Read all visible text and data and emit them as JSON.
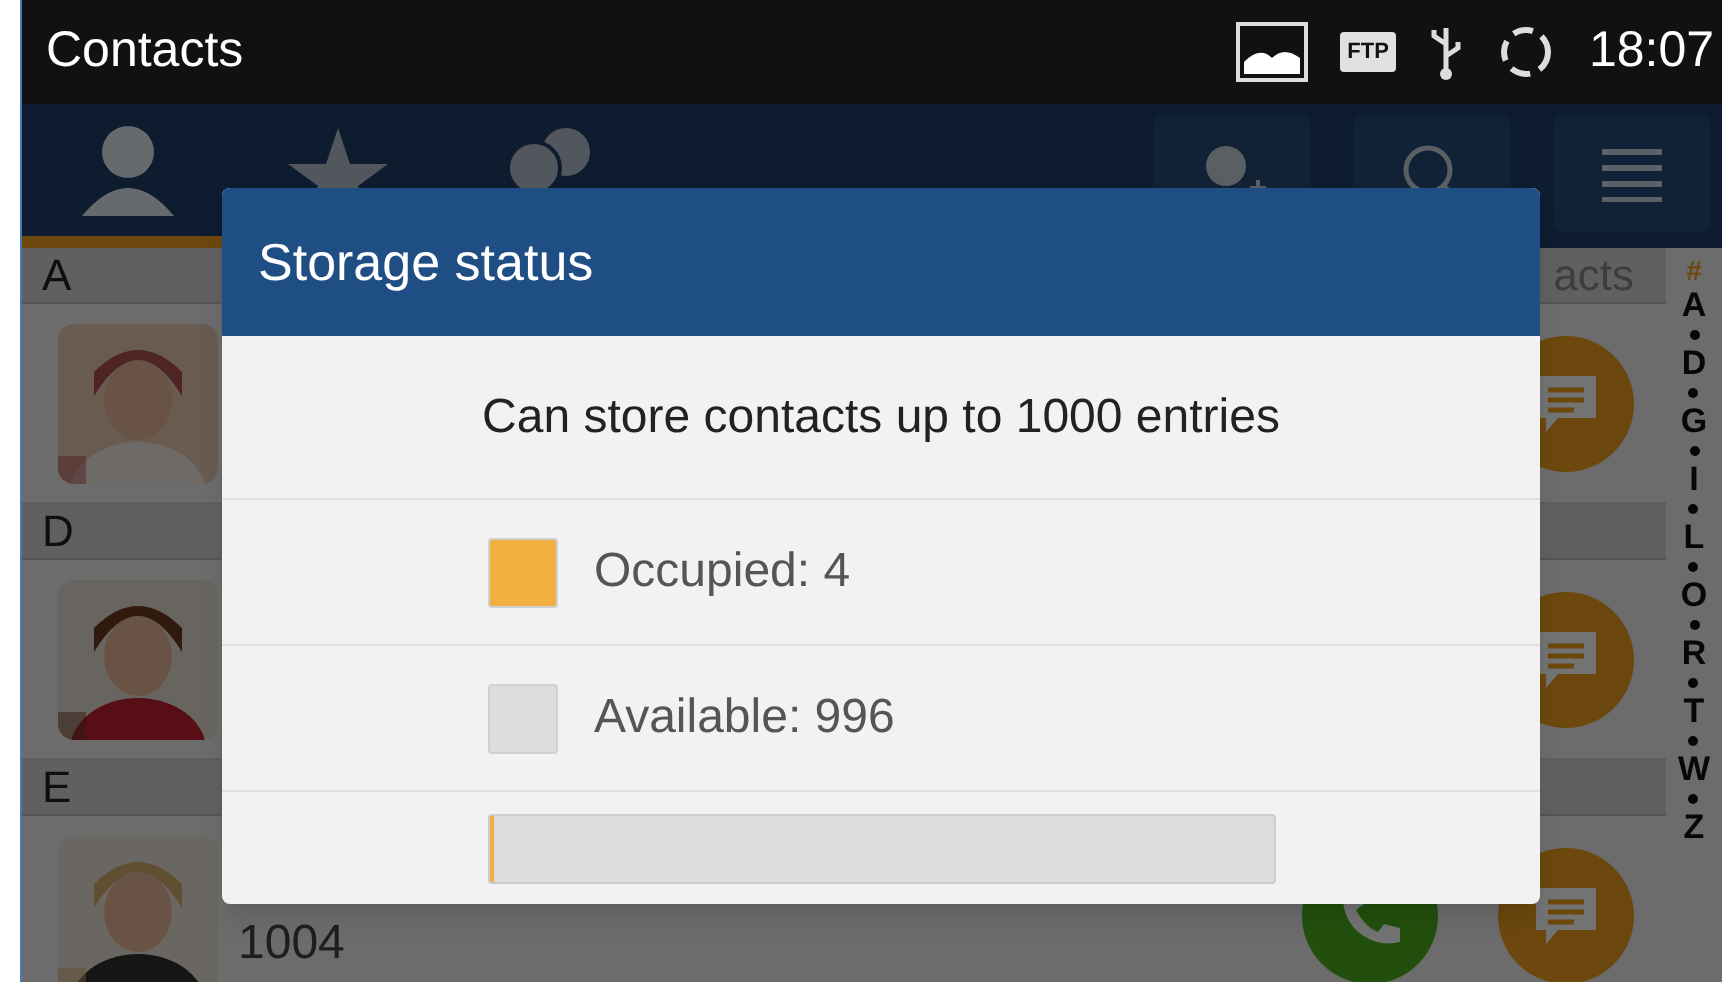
{
  "status_bar": {
    "title": "Contacts",
    "badge": "FTP",
    "time": "18:07"
  },
  "tabs": [
    {
      "kind": "person",
      "selected": true
    },
    {
      "kind": "star",
      "selected": false
    },
    {
      "kind": "group",
      "selected": false
    }
  ],
  "list": {
    "partial_heading": "acts",
    "sections": [
      {
        "letter": "A",
        "rows": [
          {}
        ]
      },
      {
        "letter": "D",
        "rows": [
          {}
        ]
      },
      {
        "letter": "E",
        "rows": [
          {
            "number": "1004"
          }
        ]
      }
    ]
  },
  "index": [
    "#",
    "A",
    "D",
    "G",
    "I",
    "L",
    "O",
    "R",
    "T",
    "W",
    "Z"
  ],
  "dialog": {
    "title": "Storage status",
    "message": "Can store contacts up to 1000 entries",
    "legend": [
      {
        "label": "Occupied: 4",
        "color": "#f0b040"
      },
      {
        "label": "Available: 996",
        "color": "#dddddd"
      }
    ],
    "bar": {
      "level": 0.004
    }
  }
}
